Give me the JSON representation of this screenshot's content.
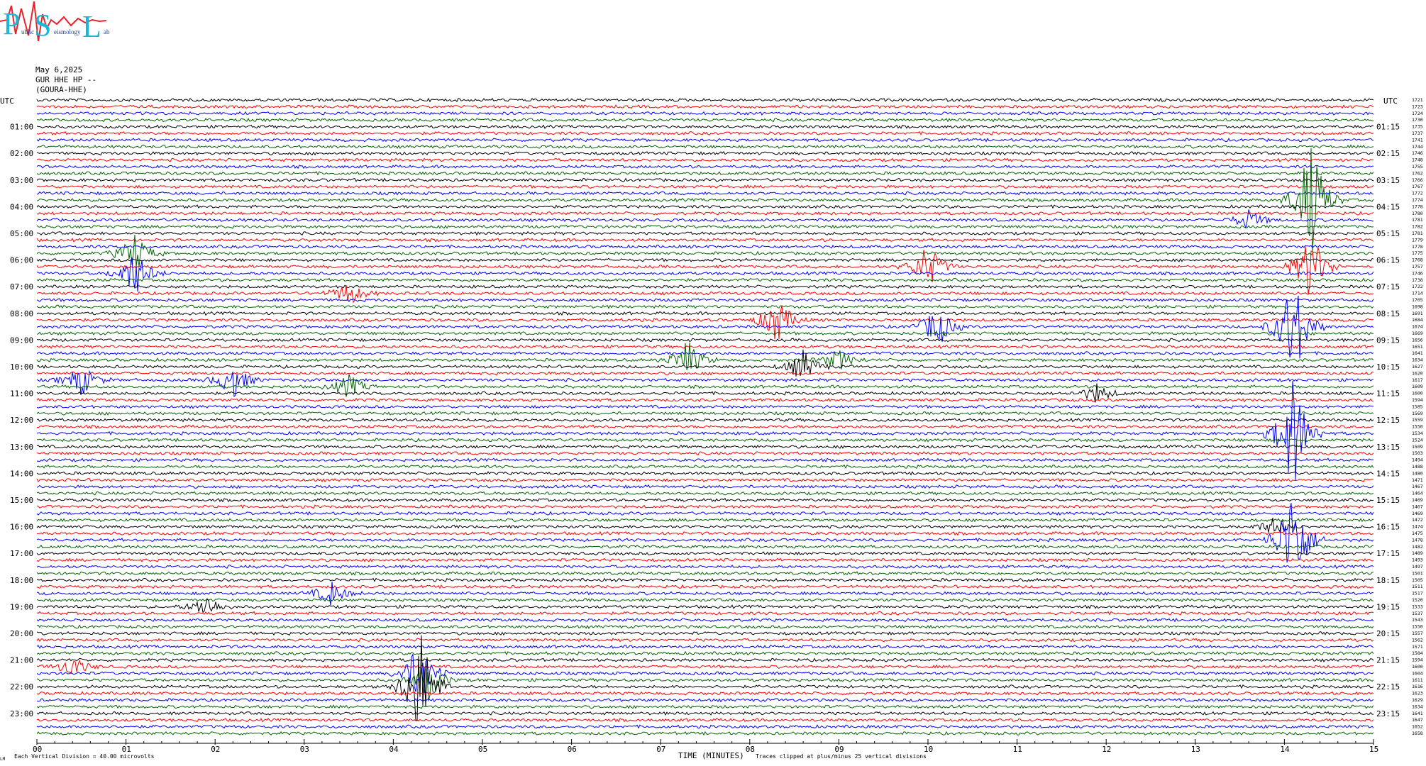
{
  "logo": {
    "letters": [
      "P",
      "S",
      "L"
    ],
    "subtitle_words": [
      "ublic",
      "eismology",
      "ab"
    ],
    "colors": {
      "letters": "#19b8d8",
      "waveform": "#e8222a"
    }
  },
  "header": {
    "date": "May 6,2025",
    "channel": "GUR HHE HP --",
    "station": "(GOURA-HHE)"
  },
  "chart_data": {
    "type": "line",
    "title": "",
    "xlabel": "TIME (MINUTES)",
    "x_range": [
      0,
      15
    ],
    "x_ticks": [
      "00",
      "01",
      "02",
      "03",
      "04",
      "05",
      "06",
      "07",
      "08",
      "09",
      "10",
      "11",
      "12",
      "13",
      "14",
      "15"
    ],
    "left_axis_title": "UTC",
    "right_axis_title": "UTC",
    "left_hour_labels": [
      "01:00",
      "02:00",
      "03:00",
      "04:00",
      "05:00",
      "06:00",
      "07:00",
      "08:00",
      "09:00",
      "10:00",
      "11:00",
      "12:00",
      "13:00",
      "14:00",
      "15:00",
      "16:00",
      "17:00",
      "18:00",
      "19:00",
      "20:00",
      "21:00",
      "22:00",
      "23:00"
    ],
    "right_hour_labels": [
      "01:15",
      "02:15",
      "03:15",
      "04:15",
      "05:15",
      "06:15",
      "07:15",
      "08:15",
      "09:15",
      "10:15",
      "11:15",
      "12:15",
      "13:15",
      "14:15",
      "15:15",
      "16:15",
      "17:15",
      "18:15",
      "19:15",
      "20:15",
      "21:15",
      "22:15",
      "23:15"
    ],
    "trace_offsets": [
      1721,
      1723,
      1724,
      1730,
      1735,
      1737,
      1741,
      1744,
      1746,
      1748,
      1755,
      1762,
      1766,
      1767,
      1772,
      1774,
      1778,
      1780,
      1781,
      1782,
      1781,
      1779,
      1778,
      1775,
      1768,
      1757,
      1746,
      1738,
      1722,
      1714,
      1705,
      1698,
      1691,
      1684,
      1674,
      1669,
      1656,
      1651,
      1641,
      1634,
      1627,
      1620,
      1617,
      1609,
      1600,
      1594,
      1585,
      1569,
      1559,
      1550,
      1534,
      1524,
      1509,
      1503,
      1494,
      1488,
      1480,
      1471,
      1467,
      1464,
      1469,
      1467,
      1469,
      1472,
      1474,
      1475,
      1478,
      1482,
      1489,
      1493,
      1497,
      1501,
      1505,
      1511,
      1517,
      1520,
      1533,
      1537,
      1543,
      1550,
      1557,
      1562,
      1571,
      1584,
      1594,
      1600,
      1604,
      1611,
      1616,
      1623,
      1629,
      1634,
      1641,
      1647,
      1652,
      1658
    ],
    "trace_colors": [
      "#000000",
      "#ff0000",
      "#0000ff",
      "#006400"
    ],
    "trace_interval_minutes": 15,
    "events": [
      {
        "trace": 88,
        "minute": 4.3,
        "amplitude": 30,
        "color": "#000000"
      },
      {
        "trace": 86,
        "minute": 4.3,
        "amplitude": 18,
        "color": "#000000"
      },
      {
        "trace": 87,
        "minute": 4.4,
        "amplitude": 10,
        "color": "#000000"
      },
      {
        "trace": 42,
        "minute": 0.5,
        "amplitude": 8,
        "color": "#000000"
      },
      {
        "trace": 42,
        "minute": 2.2,
        "amplitude": 9,
        "color": "#000000"
      },
      {
        "trace": 43,
        "minute": 3.5,
        "amplitude": 6,
        "color": "#ff0000"
      },
      {
        "trace": 23,
        "minute": 1.1,
        "amplitude": 10,
        "color": "#006400"
      },
      {
        "trace": 26,
        "minute": 1.1,
        "amplitude": 12,
        "color": "#006400"
      },
      {
        "trace": 29,
        "minute": 3.5,
        "amplitude": 6,
        "color": "#ff0000"
      },
      {
        "trace": 33,
        "minute": 8.3,
        "amplitude": 12,
        "color": "#006400"
      },
      {
        "trace": 39,
        "minute": 7.3,
        "amplitude": 10,
        "color": "#006400"
      },
      {
        "trace": 40,
        "minute": 8.6,
        "amplitude": 8,
        "color": "#006400"
      },
      {
        "trace": 39,
        "minute": 9.0,
        "amplitude": 5,
        "color": "#006400"
      },
      {
        "trace": 34,
        "minute": 10.1,
        "amplitude": 11,
        "color": "#006400"
      },
      {
        "trace": 25,
        "minute": 10.0,
        "amplitude": 12,
        "color": "#006400"
      },
      {
        "trace": 15,
        "minute": 14.3,
        "amplitude": 30,
        "color": "#006400"
      },
      {
        "trace": 25,
        "minute": 14.3,
        "amplitude": 18,
        "color": "#006400"
      },
      {
        "trace": 34,
        "minute": 14.1,
        "amplitude": 28,
        "color": "#0000ff"
      },
      {
        "trace": 50,
        "minute": 14.1,
        "amplitude": 30,
        "color": "#0000ff"
      },
      {
        "trace": 66,
        "minute": 14.1,
        "amplitude": 30,
        "color": "#0000ff"
      },
      {
        "trace": 44,
        "minute": 11.9,
        "amplitude": 5,
        "color": "#0000ff"
      },
      {
        "trace": 74,
        "minute": 3.3,
        "amplitude": 6,
        "color": "#0000ff"
      },
      {
        "trace": 76,
        "minute": 1.9,
        "amplitude": 6,
        "color": "#000000"
      },
      {
        "trace": 85,
        "minute": 0.4,
        "amplitude": 5,
        "color": "#0000ff"
      },
      {
        "trace": 64,
        "minute": 13.9,
        "amplitude": 5,
        "color": "#000000"
      },
      {
        "trace": 18,
        "minute": 13.6,
        "amplitude": 5,
        "color": "#0000ff"
      }
    ]
  },
  "footer": {
    "vertical_division": "Each Vertical Division =    40.00 microvolts",
    "clip_note": "Traces clipped at plus/minus 25 vertical divisions",
    "corner_mark": "LM"
  }
}
